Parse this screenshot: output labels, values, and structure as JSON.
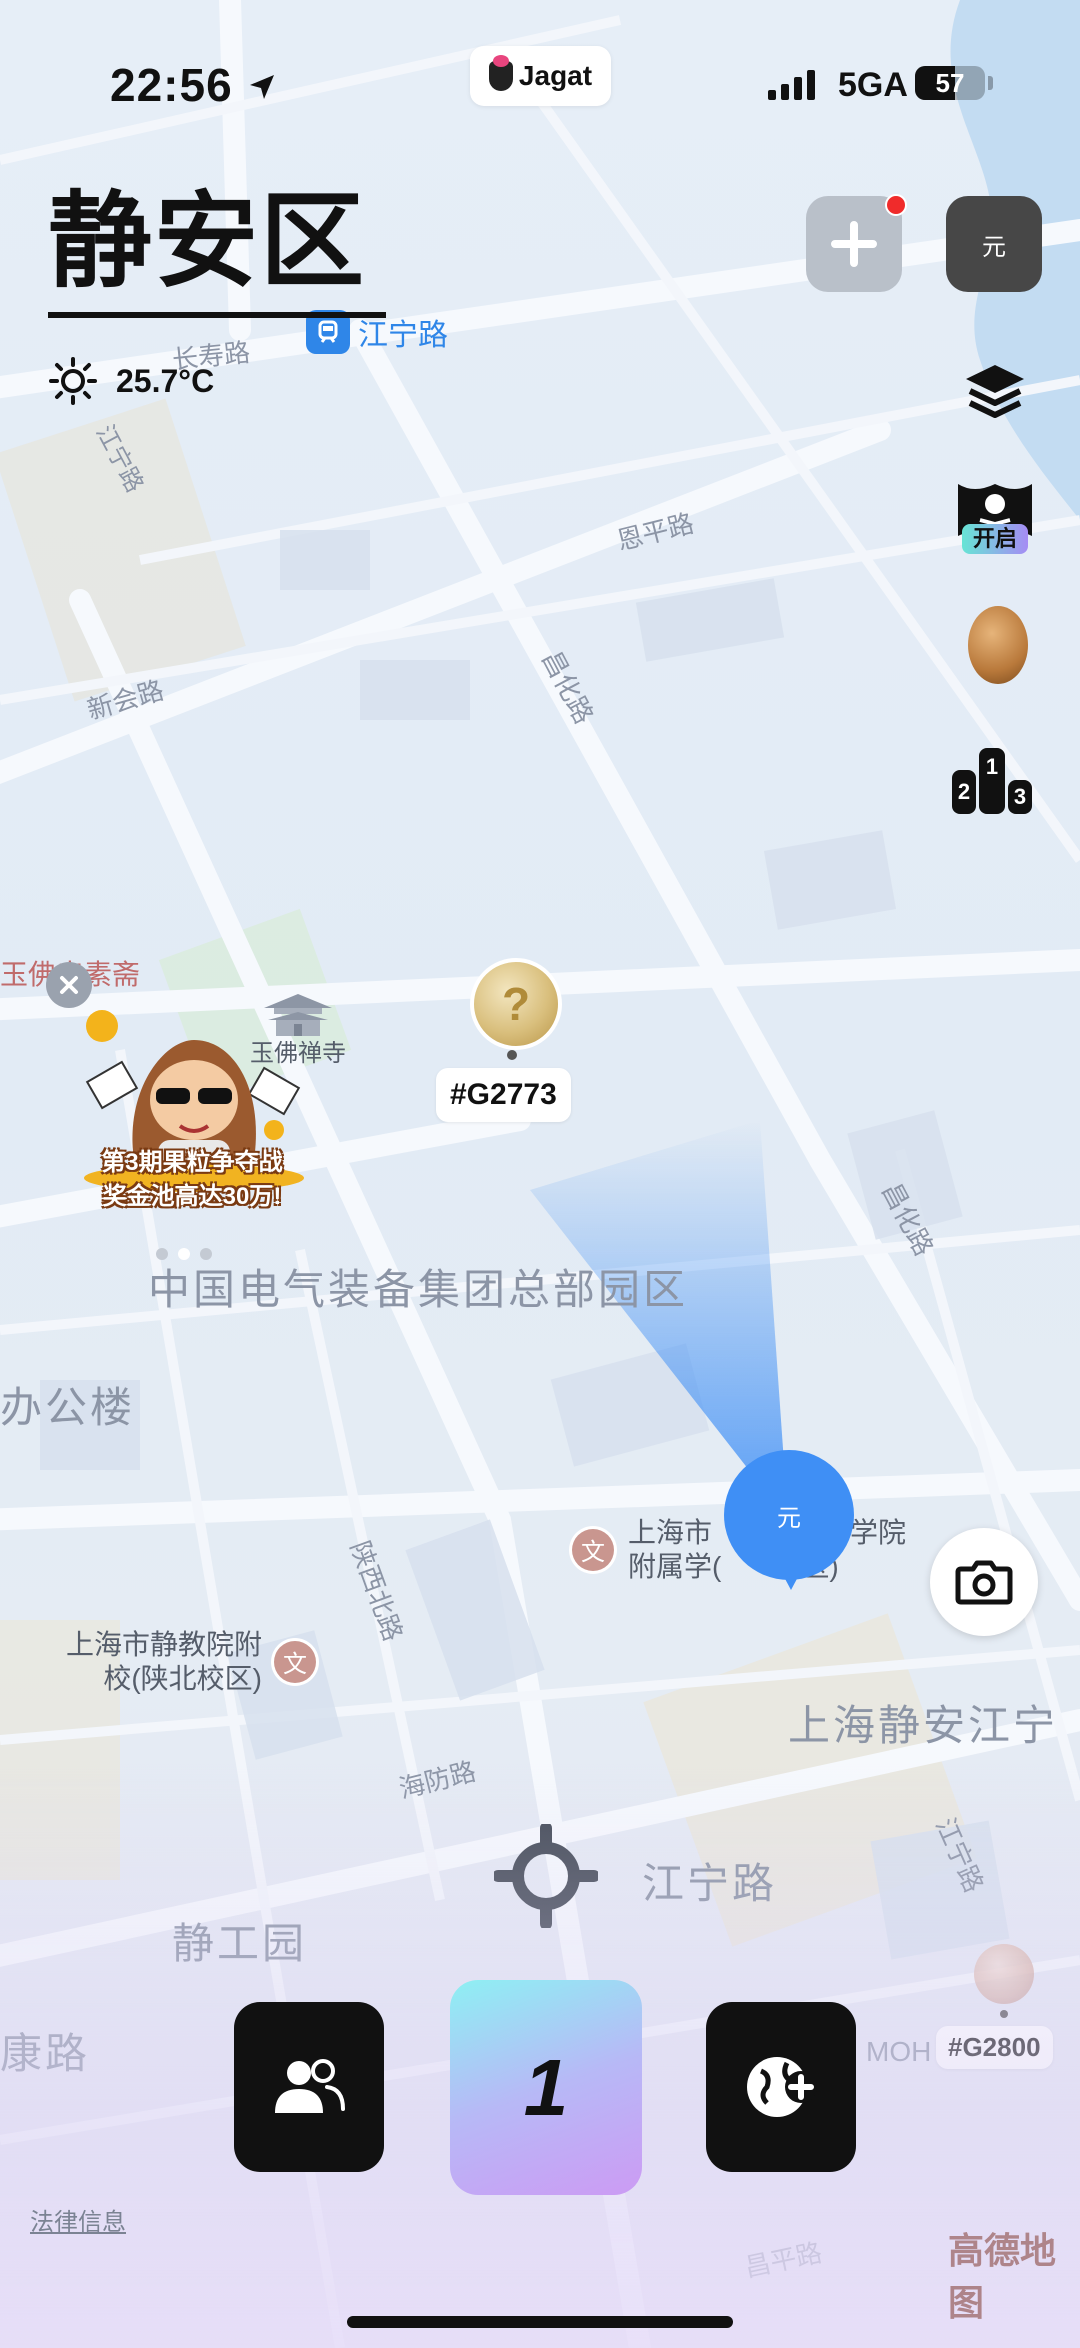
{
  "status_bar": {
    "time": "22:56",
    "app_badge": "Jagat",
    "network": "5GA",
    "battery": "57",
    "battery_level": 0.57
  },
  "header": {
    "district": "静安区",
    "temperature": "25.7°C",
    "weather_icon": "sun-icon"
  },
  "top_actions": {
    "add_icon": "plus-icon",
    "currency_label": "元"
  },
  "side_toolbar": {
    "layers_icon": "layers-icon",
    "treasure_label": "开启",
    "coin_icon": "coin-icon",
    "leaderboard_icon": "podium-icon",
    "podium": [
      "2",
      "1",
      "3"
    ]
  },
  "map": {
    "metro_station": "江宁路",
    "streets": [
      "长寿路",
      "江宁路",
      "恩平路",
      "新会路",
      "昌化路",
      "昌化路",
      "陕西北路",
      "海防路",
      "江宁路",
      "昌平路"
    ],
    "area_labels": [
      "中国电气装备集团总部园区",
      "办公楼",
      "上海静安江宁",
      "静工园",
      "江宁路",
      "康路",
      "MOH"
    ],
    "pois": [
      {
        "name": "玉佛禅寺"
      },
      {
        "name": "玉佛寺素斋"
      },
      {
        "name": "上海市静教院附校(陕北校区)",
        "line1": "上海市静教院附",
        "line2": "校(陕北校区)",
        "icon": "文"
      },
      {
        "name": "上海市…育学院附属学(…区)",
        "line1": "上海市",
        "line1b": "育学院",
        "line2": "附属学(",
        "line2b": "区)",
        "icon": "文"
      }
    ],
    "geo_tags": [
      {
        "label": "#G2773",
        "coin_symbol": "?"
      },
      {
        "label": "#G2800"
      }
    ],
    "user_marker_label": "元"
  },
  "promo": {
    "line1": "第3期果粒争夺战",
    "line2": "奖金池高达30万!",
    "close_icon": "close-icon"
  },
  "bottom_bar": {
    "friends_icon": "people-icon",
    "center_label": "1",
    "explore_icon": "globe-plus-icon"
  },
  "footer": {
    "legal": "法律信息",
    "map_provider": "高德地图"
  },
  "colors": {
    "accent_blue": "#3f8ff5",
    "dark_button": "#111111",
    "notification_red": "#f02b2b"
  }
}
